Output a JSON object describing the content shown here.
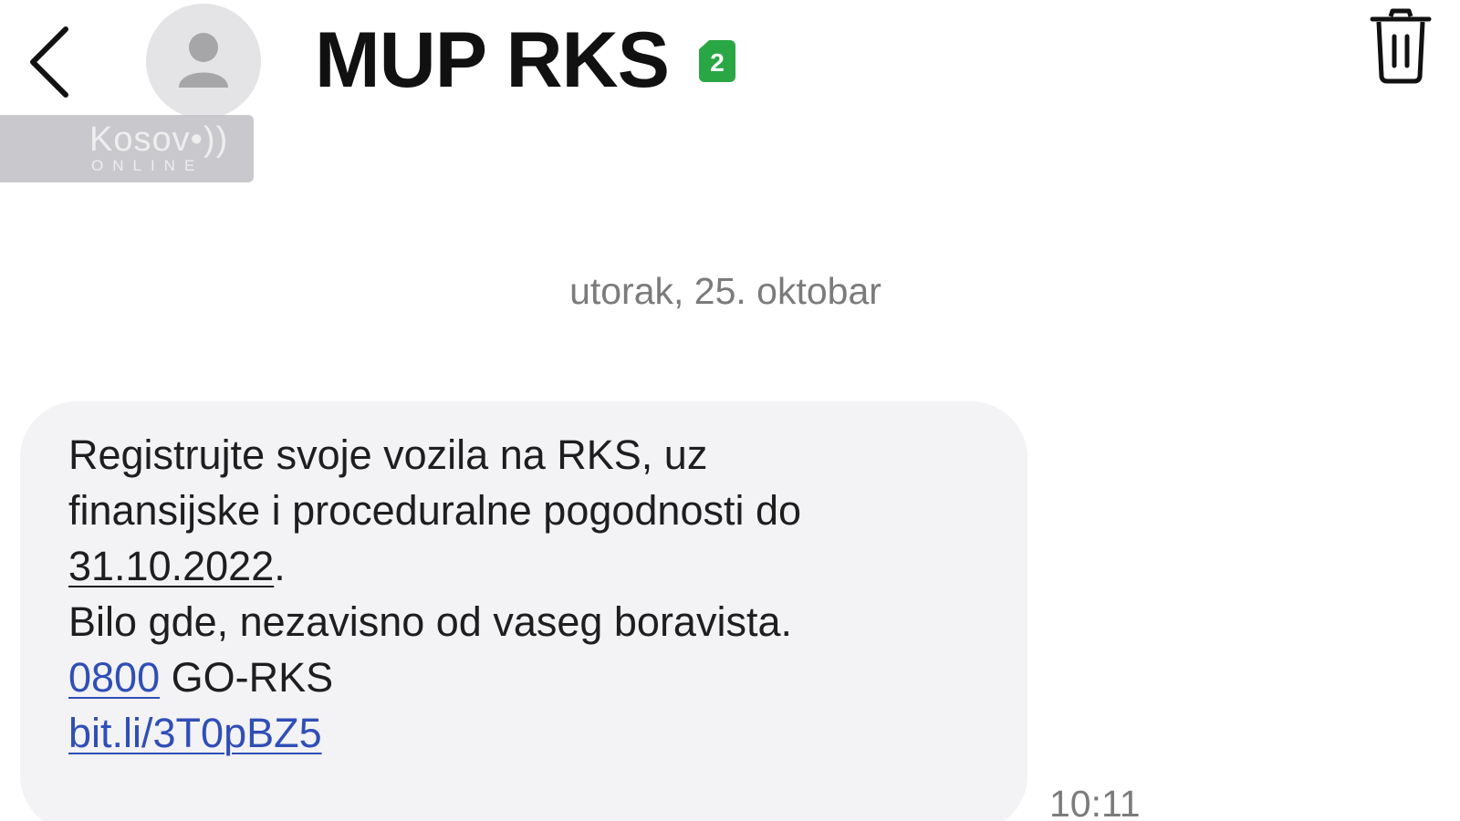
{
  "header": {
    "contact_name": "MUP RKS",
    "sim_badge": "2",
    "back_icon": "chevron-left-icon",
    "avatar_icon": "person-icon",
    "delete_icon": "trash-icon"
  },
  "watermark": {
    "brand_top": "Kosov•))",
    "brand_bottom": "ONLINE"
  },
  "conversation": {
    "date_separator": "utorak, 25. oktobar",
    "message": {
      "line1": "Registrujte svoje vozila na RKS, uz",
      "line2": "finansijske i proceduralne pogodnosti do",
      "date_link": "31.10.2022",
      "date_suffix": ".",
      "line4": "Bilo gde, nezavisno od vaseg boravista.",
      "phone_link": "0800",
      "phone_rest": " GO-RKS",
      "url_link": "bit.li/3T0pBZ5",
      "time": "10:11"
    }
  },
  "colors": {
    "link": "#2f4fb6",
    "sim_badge": "#2aa745",
    "bubble": "#f3f2f5",
    "meta_text": "#7b7b7b"
  }
}
